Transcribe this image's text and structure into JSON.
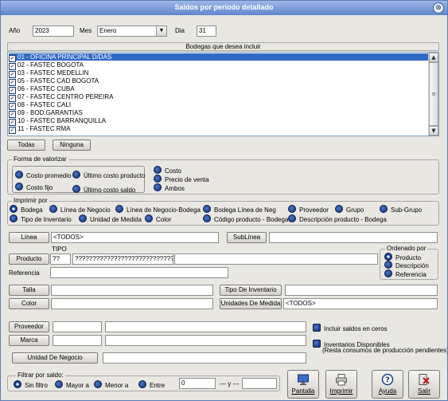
{
  "window": {
    "title": "Saldos por período detallado",
    "close_glyph": "⊗"
  },
  "date": {
    "year_label": "Año",
    "year_value": "2023",
    "month_label": "Mes",
    "month_value": "Enero",
    "day_label": "Dia",
    "day_value": "31"
  },
  "bodegas": {
    "heading": "Bodegas que desea incluir",
    "items": [
      {
        "label": "01 - OFICINA PRINCIPAL D/DAS",
        "checked": true,
        "selected": true
      },
      {
        "label": "02 - FASTEC BOGOTA",
        "checked": true
      },
      {
        "label": "03 - FASTEC MEDELLIN",
        "checked": true
      },
      {
        "label": "05 - FASTEC CAD BOGOTA",
        "checked": true
      },
      {
        "label": "06 - FASTEC CUBA",
        "checked": true
      },
      {
        "label": "07 - FASTEC CENTRO PEREIRA",
        "checked": true
      },
      {
        "label": "08 - FASTEC CALI",
        "checked": true
      },
      {
        "label": "09 - BOD.GARANTIAS",
        "checked": true
      },
      {
        "label": "10 - FASTEC BARRANQUILLA",
        "checked": true
      },
      {
        "label": "11 - FASTEC RMA",
        "checked": true
      }
    ],
    "all_button": "Todas",
    "none_button": "Ninguna"
  },
  "valorizar": {
    "title": "Forma de valorizar",
    "promedio": "Costo promedio",
    "ultimo_producto": "Último costo producto",
    "fijo": "Costo fijo",
    "ultimo_saldo": "Último costo saldo",
    "costo": "Costo",
    "precio": "Precio de venta",
    "ambos": "Ambos"
  },
  "imprimir_por": {
    "title": "Imprimir por",
    "options": [
      "Bodega",
      "Línea de Negocio",
      "Línea de Negocio-Bodega",
      "Bodega Línea de Neg",
      "Proveedor",
      "Grupo",
      "Sub-Grupo",
      "Tipo de Inventario",
      "Unidad de Medida",
      "Color",
      "Código producto - Bodega",
      "Descripción producto - Bodega"
    ]
  },
  "filters": {
    "linea_button": "Línea",
    "linea_value": "<TODOS>",
    "sublinea_button": "SubLínea",
    "tipo_label": "TIPO",
    "producto_button": "Producto",
    "tipo_value": "??",
    "producto_value": "????????????????????????????",
    "referencia_label": "Referencia",
    "talla_button": "Talla",
    "tipo_inventario_button": "Tipo De Inventario",
    "color_button": "Color",
    "unidades_button": "Unidades De Medida",
    "unidades_value": "<TODOS>",
    "proveedor_button": "Proveedor",
    "marca_button": "Marca",
    "unidad_negocio_button": "Unidad De Negocio"
  },
  "ordenado": {
    "title": "Ordenado por",
    "producto": "Producto",
    "descripcion": "Descripción",
    "referencia": "Referencia"
  },
  "options": {
    "ceros": "Incluir saldos en ceros",
    "disponibles_line1": "Inventarios Disponibles",
    "disponibles_line2": "(Resta consumos de producción pendientes)"
  },
  "saldo_filter": {
    "title": "Filtrar por saldo:",
    "sin_filtro": "Sin filtro",
    "mayor": "Mayor a",
    "menor": "Menor a",
    "entre": "Entre",
    "value": "0",
    "separator": "--- y ---"
  },
  "actions": {
    "pantalla": "Pantalla",
    "pantalla_icon": "monitor-icon",
    "imprimir": "Imprimir",
    "imprimir_icon": "printer-icon",
    "ayuda": "Ayuda",
    "ayuda_icon": "help-icon",
    "salir": "Salir",
    "salir_icon": "exit-icon"
  },
  "colors": {
    "selection": "#316ac5",
    "title_bar": "#5f86cf",
    "radio": "#0f2b73"
  }
}
